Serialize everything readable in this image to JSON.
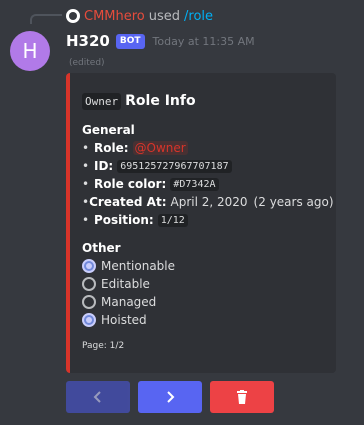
{
  "reply": {
    "user": "CMMhero",
    "used_text": "used",
    "command": "/role"
  },
  "message": {
    "avatar_letter": "H",
    "username": "H320",
    "bot_tag": "BOT",
    "timestamp": "Today at 11:35 AM",
    "edited": "(edited)"
  },
  "embed": {
    "accent_color": "#d7342a",
    "title_code": "Owner",
    "title_text": "Role Info",
    "general_title": "General",
    "fields": [
      {
        "label": "Role:",
        "value": "@Owner"
      },
      {
        "label": "ID:",
        "value": "695125727967707187"
      },
      {
        "label": "Role color:",
        "value": "#D7342A"
      },
      {
        "label": "Created At:",
        "value": "April 2, 2020 (2 years ago)"
      },
      {
        "label": "Position:",
        "value": "1/12"
      }
    ],
    "other_title": "Other",
    "options": [
      {
        "label": "Mentionable",
        "checked": true
      },
      {
        "label": "Editable",
        "checked": false
      },
      {
        "label": "Managed",
        "checked": false
      },
      {
        "label": "Hoisted",
        "checked": true
      }
    ],
    "footer": "Page: 1/2"
  },
  "buttons": {
    "prev_icon": "chevron-left-icon",
    "next_icon": "chevron-right-icon",
    "delete_icon": "trash-icon"
  },
  "bullet": "•"
}
